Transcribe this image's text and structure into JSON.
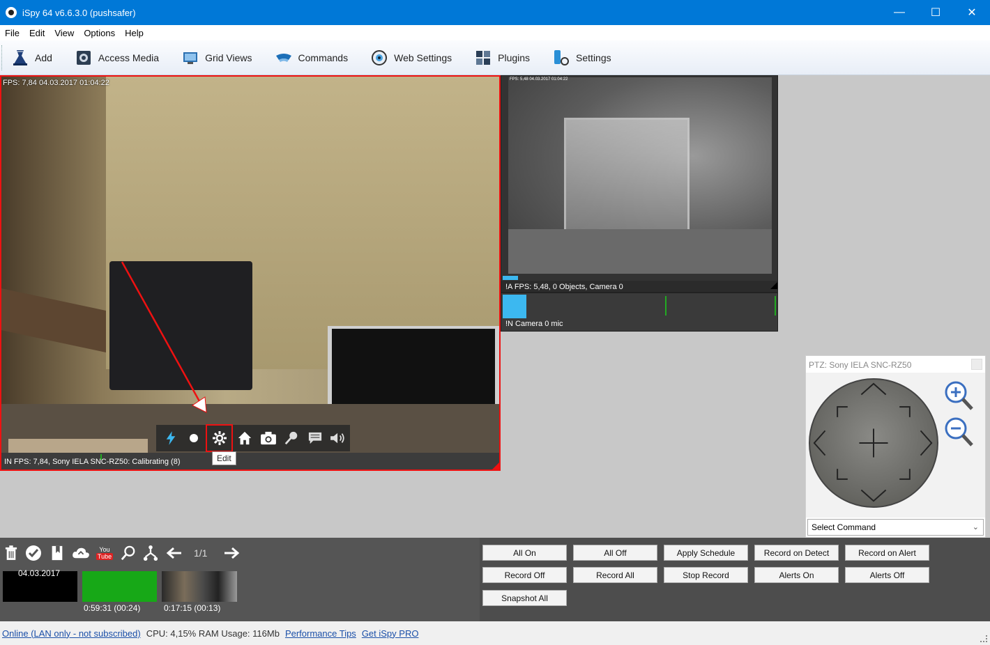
{
  "window": {
    "title": "iSpy 64 v6.6.3.0 (pushsafer)",
    "minimize": "—",
    "maximize": "☐",
    "close": "✕"
  },
  "menu": [
    "File",
    "Edit",
    "View",
    "Options",
    "Help"
  ],
  "toolbar": [
    {
      "label": "Add",
      "icon": "add-camera-icon"
    },
    {
      "label": "Access Media",
      "icon": "media-icon"
    },
    {
      "label": "Grid Views",
      "icon": "grid-views-icon"
    },
    {
      "label": "Commands",
      "icon": "commands-icon"
    },
    {
      "label": "Web Settings",
      "icon": "web-settings-icon"
    },
    {
      "label": "Plugins",
      "icon": "plugins-icon"
    },
    {
      "label": "Settings",
      "icon": "settings-icon"
    }
  ],
  "camera1": {
    "overlay": "FPS: 7,84 04.03.2017 01:04:22",
    "status": "IN  FPS: 7,84, Sony IELA SNC-RZ50: Calibrating (8)",
    "tooltip": "Edit",
    "controls": [
      "lightning-icon",
      "record-icon",
      "edit-gear-icon",
      "home-icon",
      "snapshot-icon",
      "talk-icon",
      "message-icon",
      "speaker-icon"
    ]
  },
  "camera2": {
    "overlay": "FPS: 5,48 04.03.2017 01:04:22",
    "status": "!A  FPS: 5,48, 0 Objects, Camera 0"
  },
  "microphone": {
    "status": "!N  Camera 0 mic"
  },
  "ptz": {
    "title": "PTZ: Sony IELA SNC-RZ50",
    "select_command": "Select Command"
  },
  "media_toolbar": {
    "page": "1/1",
    "icons": [
      "delete-icon",
      "check-icon",
      "bookmark-icon",
      "upload-cloud-icon",
      "youtube-icon",
      "search-icon",
      "merge-icon",
      "prev-arrow-icon",
      "next-arrow-icon"
    ],
    "youtube_top": "You",
    "youtube_bottom": "Tube"
  },
  "thumbnails": [
    {
      "date": "04.03.2017",
      "label": ""
    },
    {
      "date": "",
      "label": "0:59:31 (00:24)"
    },
    {
      "date": "",
      "label": "0:17:15 (00:13)"
    }
  ],
  "commands": [
    [
      "All On",
      "All Off",
      "Apply Schedule",
      "Record on Detect",
      "Record on Alert"
    ],
    [
      "Record Off",
      "Record All",
      "Stop Record",
      "Alerts On",
      "Alerts Off"
    ],
    [
      "Snapshot All"
    ]
  ],
  "statusbar": {
    "online": "Online (LAN only - not subscribed)",
    "usage": "CPU: 4,15% RAM Usage: 116Mb",
    "perf_tips": "Performance Tips",
    "get_pro": "Get iSpy PRO"
  },
  "colors": {
    "titlebar": "#0078d7",
    "selection_border": "#e11111",
    "level_blue": "#3cb8f0"
  }
}
